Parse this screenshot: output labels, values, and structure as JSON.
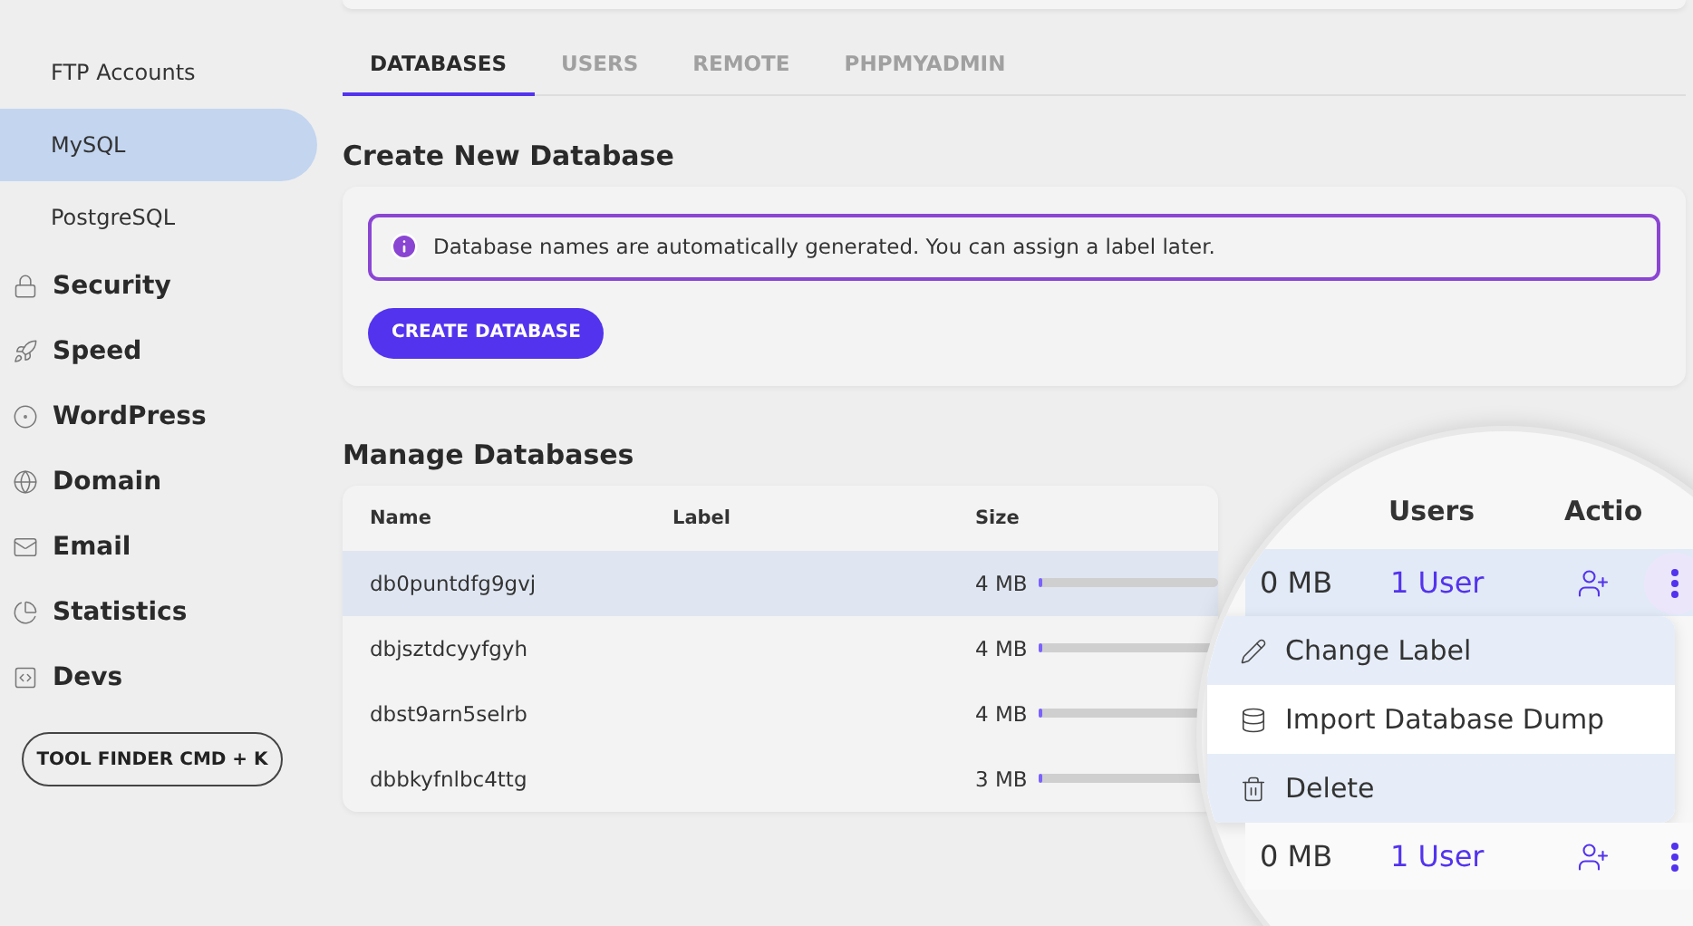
{
  "sidebar": {
    "sub_items": [
      {
        "label": "FTP Accounts",
        "selected": false
      },
      {
        "label": "MySQL",
        "selected": true
      },
      {
        "label": "PostgreSQL",
        "selected": false
      }
    ],
    "sections": [
      {
        "label": "Security"
      },
      {
        "label": "Speed"
      },
      {
        "label": "WordPress"
      },
      {
        "label": "Domain"
      },
      {
        "label": "Email"
      },
      {
        "label": "Statistics"
      },
      {
        "label": "Devs"
      }
    ],
    "tool_finder": "TOOL FINDER CMD + K"
  },
  "tabs": [
    {
      "label": "DATABASES",
      "selected": true
    },
    {
      "label": "USERS",
      "selected": false
    },
    {
      "label": "REMOTE",
      "selected": false
    },
    {
      "label": "PHPMYADMIN",
      "selected": false
    }
  ],
  "create": {
    "title": "Create New Database",
    "notice": "Database names are automatically generated. You can assign a label later.",
    "button": "CREATE DATABASE"
  },
  "manage": {
    "title": "Manage Databases",
    "columns": [
      "Name",
      "Label",
      "Size"
    ],
    "rows": [
      {
        "name": "db0puntdfg9gvj",
        "size": "4 MB",
        "level": 0.01,
        "selected": true
      },
      {
        "name": "dbjsztdcyyfgyh",
        "size": "4 MB",
        "level": 0.01,
        "selected": false
      },
      {
        "name": "dbst9arn5selrb",
        "size": "4 MB",
        "level": 0.01,
        "selected": false
      },
      {
        "name": "dbbkyfnlbc4ttg",
        "size": "3 MB",
        "level": 0.01,
        "selected": false
      }
    ]
  },
  "magnifier": {
    "columns": [
      "Users",
      "Actio"
    ],
    "rows": [
      {
        "size": "0 MB",
        "users": "1 User",
        "menu_open": true
      },
      {
        "size": "0 MB",
        "users": "1 User",
        "menu_open": false
      }
    ],
    "menu": [
      {
        "label": "Change Label",
        "highlighted": true
      },
      {
        "label": "Import Database Dump",
        "highlighted": false
      },
      {
        "label": "Delete",
        "highlighted": true
      }
    ]
  }
}
